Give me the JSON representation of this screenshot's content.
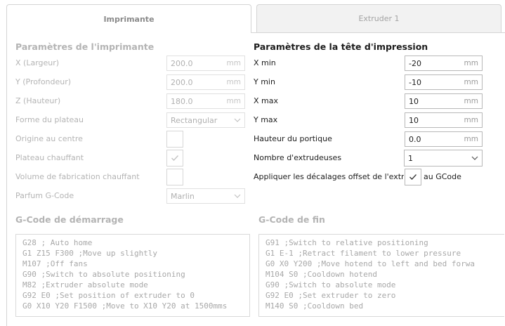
{
  "tabs": [
    {
      "label": "Imprimante",
      "active": true
    },
    {
      "label": "Extruder 1",
      "active": false
    }
  ],
  "printer": {
    "title": "Paramètres de l'imprimante",
    "rows": [
      {
        "label": "X (Largeur)",
        "value": "200.0",
        "unit": "mm"
      },
      {
        "label": "Y (Profondeur)",
        "value": "200.0",
        "unit": "mm"
      },
      {
        "label": "Z (Hauteur)",
        "value": "180.0",
        "unit": "mm"
      },
      {
        "label": "Forme du plateau",
        "value": "Rectangular"
      },
      {
        "label": "Origine au centre",
        "checked": false
      },
      {
        "label": "Plateau chauffant",
        "checked": true
      },
      {
        "label": "Volume de fabrication chauffant",
        "checked": false
      },
      {
        "label": "Parfum G-Code",
        "value": "Marlin"
      }
    ]
  },
  "head": {
    "title": "Paramètres de la tête d'impression",
    "rows": [
      {
        "label": "X min",
        "value": "-20",
        "unit": "mm"
      },
      {
        "label": "Y min",
        "value": "-10",
        "unit": "mm"
      },
      {
        "label": "X max",
        "value": "10",
        "unit": "mm"
      },
      {
        "label": "Y max",
        "value": "10",
        "unit": "mm"
      },
      {
        "label": "Hauteur du portique",
        "value": "0.0",
        "unit": "mm"
      },
      {
        "label": "Nombre d'extrudeuses",
        "value": "1"
      },
      {
        "label": "Appliquer les décalages offset de l'extrud",
        "checked": true,
        "suffix": "au GCode"
      }
    ]
  },
  "start_gcode": {
    "title": "G-Code de démarrage",
    "lines": [
      "G28 ; Auto home",
      "G1 Z15 F300 ;Move up slightly",
      "M107 ;Off fans",
      "G90 ;Switch to absolute positioning",
      "M82 ;Extruder absolute mode",
      "G92 E0 ;Set position of extruder to 0",
      "G0 X10 Y20 F1500 ;Move to X10 Y20 at 1500mms"
    ]
  },
  "end_gcode": {
    "title": "G-Code de fin",
    "lines": [
      "G91 ;Switch to relative positioning",
      "G1 E-1 ;Retract filament to lower pressure",
      "G0 X0 Y200 ;Move hotend to left and bed forwa",
      "M104 S0 ;Cooldown hotend",
      "G90 ;Switch to absolute mode",
      "G92 E0 ;Set extruder to zero",
      "M140 S0 ;Cooldown bed"
    ]
  },
  "icons": {
    "dropdown": "chevron-down-icon",
    "checkbox": "checkmark-icon"
  }
}
